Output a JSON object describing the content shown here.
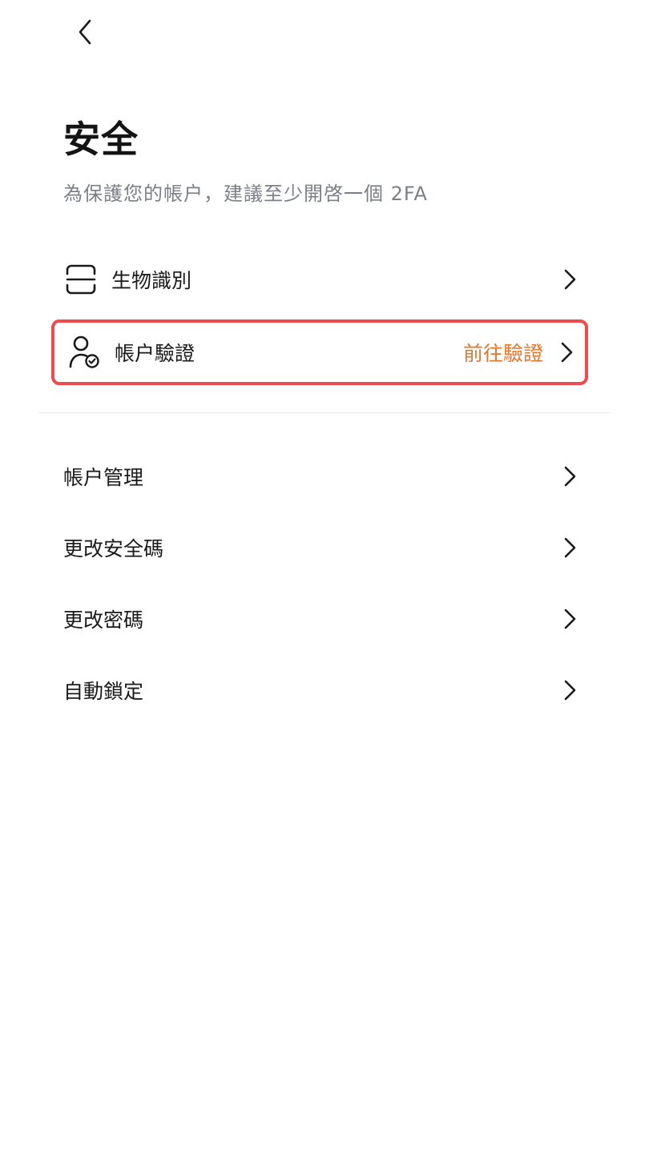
{
  "header": {
    "back_icon": "chevron-left-icon"
  },
  "page": {
    "title": "安全",
    "subtitle": "為保護您的帳户，建議至少開啓一個 2FA"
  },
  "security_items": [
    {
      "icon": "face-scan-icon",
      "label": "生物識別",
      "action": ""
    },
    {
      "icon": "user-check-icon",
      "label": "帳户驗證",
      "action": "前往驗證",
      "highlighted": true
    }
  ],
  "settings_items": [
    {
      "label": "帳户管理"
    },
    {
      "label": "更改安全碼"
    },
    {
      "label": "更改密碼"
    },
    {
      "label": "自動鎖定"
    }
  ],
  "colors": {
    "accent": "#e5762b",
    "highlight_border": "#ee4b4b",
    "subtitle": "#7b7f86"
  }
}
